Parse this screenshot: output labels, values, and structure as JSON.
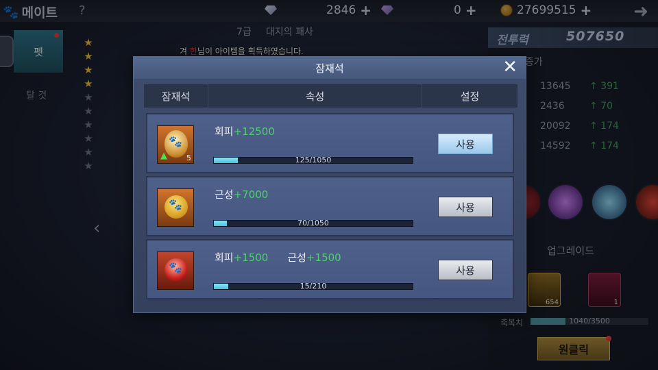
{
  "topbar": {
    "title": "메이트",
    "help": "?",
    "gem1": "2846",
    "gem2": "0",
    "gold": "27699515",
    "plus": "+"
  },
  "left_nav": {
    "pet_tab": "펫",
    "ride_tab": "탈 것"
  },
  "pet": {
    "level": "7급",
    "name": "대지의 패사"
  },
  "notice": {
    "prefix": "겨 ",
    "highlight": "한",
    "suffix": "님이 아이템을 획득하였습니다."
  },
  "right_panel": {
    "power_label": "전투력",
    "power_value": "507650",
    "section_label": "증가",
    "stats": [
      {
        "value": "13645",
        "inc": "391"
      },
      {
        "value": "2436",
        "inc": "70"
      },
      {
        "value": "20092",
        "inc": "174"
      },
      {
        "value": "14592",
        "inc": "174"
      }
    ],
    "upgrade_title": "업그레이드",
    "upgrade_items": [
      {
        "count": "654"
      },
      {
        "count": "1"
      }
    ],
    "exp_label": "축복치",
    "exp_text": "1040/3500",
    "exp_fraction": 0.297,
    "oneclick_label": "원클릭"
  },
  "modal": {
    "title": "잠재석",
    "close": "✕",
    "columns": [
      "잠재석",
      "속성",
      "설정"
    ],
    "rows": [
      {
        "icon": "paw-egg-gold-icon",
        "badge_up": "▲",
        "count": "5",
        "attr1_name": "회피",
        "attr1_value": "+12500",
        "attr2_name": "",
        "attr2_value": "",
        "progress_text": "125/1050",
        "progress_fraction": 0.119,
        "button_label": "사용",
        "button_active": true
      },
      {
        "icon": "paw-orb-gold-icon",
        "badge_up": "",
        "count": "",
        "attr1_name": "근성",
        "attr1_value": "+7000",
        "attr2_name": "",
        "attr2_value": "",
        "progress_text": "70/1050",
        "progress_fraction": 0.067,
        "button_label": "사용",
        "button_active": false
      },
      {
        "icon": "paw-orb-red-icon",
        "badge_up": "",
        "count": "",
        "attr1_name": "회피",
        "attr1_value": "+1500",
        "attr2_name": "근성",
        "attr2_value": "+1500",
        "progress_text": "15/210",
        "progress_fraction": 0.071,
        "button_label": "사용",
        "button_active": false
      }
    ]
  }
}
